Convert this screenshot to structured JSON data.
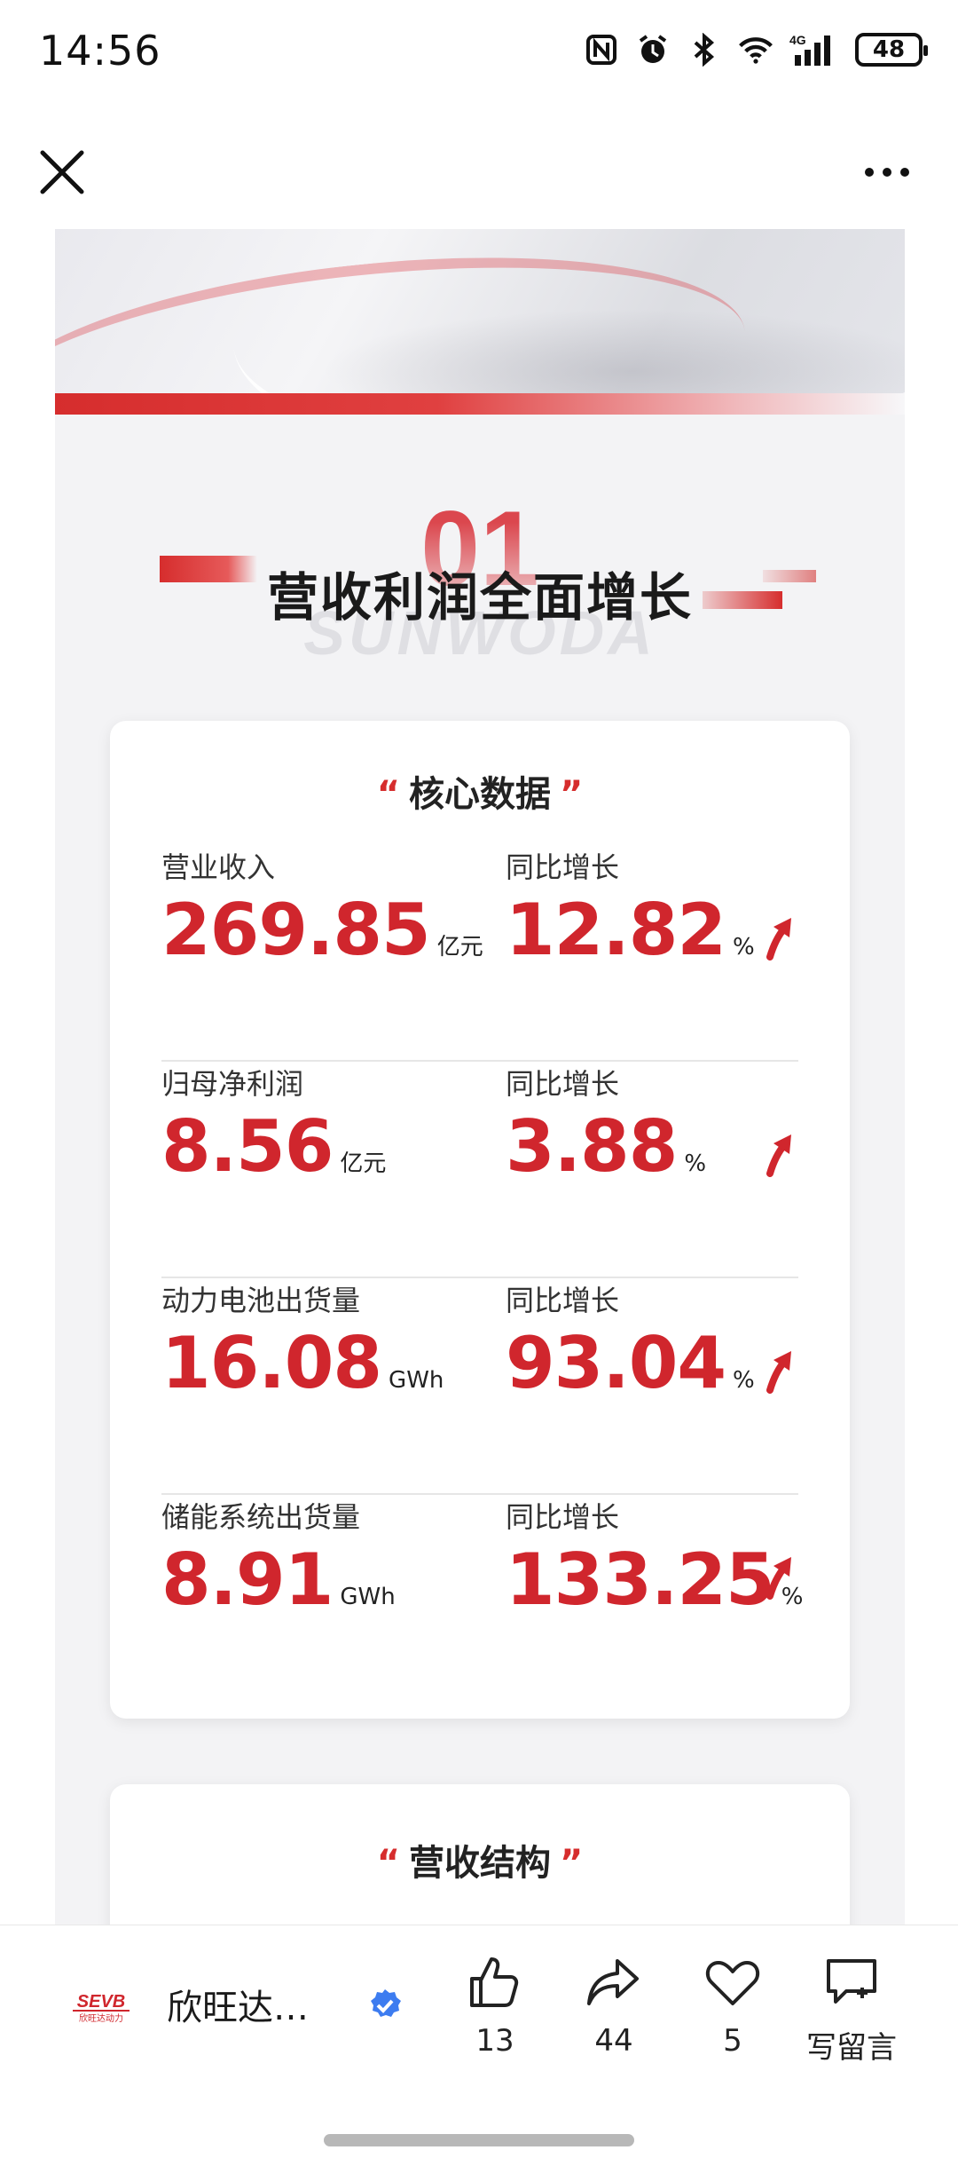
{
  "status_bar": {
    "time": "14:56",
    "battery": "48",
    "icons": [
      "nfc-icon",
      "alarm-icon",
      "bluetooth-icon",
      "wifi-icon",
      "signal-4g-icon",
      "battery-icon"
    ]
  },
  "nav": {
    "close_icon": "close-icon",
    "more_icon": "more-icon"
  },
  "section": {
    "number": "01",
    "watermark": "SUNWODA",
    "title": "营收利润全面增长"
  },
  "core_card": {
    "title": "核心数据",
    "quote_open": "“",
    "quote_close": "”",
    "rows": [
      {
        "label": "营业收入",
        "value": "269.85",
        "unit": "亿元",
        "growth_label": "同比增长",
        "growth_value": "12.82",
        "growth_unit": "%"
      },
      {
        "label": "归母净利润",
        "value": "8.56",
        "unit": "亿元",
        "growth_label": "同比增长",
        "growth_value": "3.88",
        "growth_unit": "%"
      },
      {
        "label": "动力电池出货量",
        "value": "16.08",
        "unit": "GWh",
        "growth_label": "同比增长",
        "growth_value": "93.04",
        "growth_unit": "%"
      },
      {
        "label": "储能系统出货量",
        "value": "8.91",
        "unit": "GWh",
        "growth_label": "同比增长",
        "growth_value": "133.25",
        "growth_unit": "%"
      }
    ]
  },
  "structure_card": {
    "title": "营收结构"
  },
  "bottom_bar": {
    "brand_logo_text": "SEVB",
    "brand_logo_sub": "欣旺达动力",
    "brand_name": "欣旺达…",
    "likes": "13",
    "shares": "44",
    "favorites": "5",
    "comment_label": "写留言"
  },
  "colors": {
    "accent": "#d0262d",
    "verified": "#3d7cf0"
  }
}
